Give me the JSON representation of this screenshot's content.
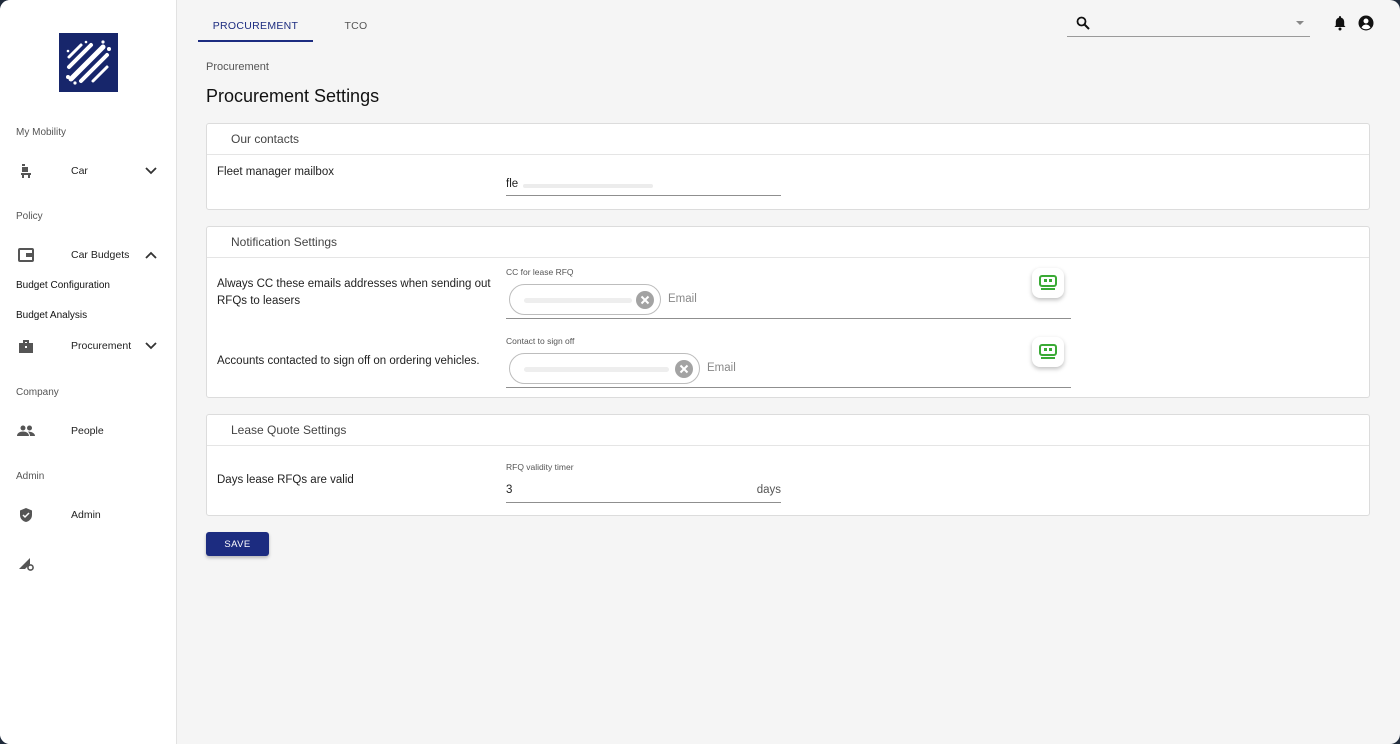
{
  "colors": {
    "brand": "#17266b",
    "accent": "#1c2c80",
    "extension": "#3aaa35"
  },
  "sidebar": {
    "sections": {
      "my_mobility": "My Mobility",
      "policy": "Policy",
      "company": "Company",
      "admin": "Admin"
    },
    "items": {
      "car": {
        "label": "Car",
        "icon": "car-seat-icon"
      },
      "car_budgets": {
        "label": "Car Budgets",
        "icon": "wallet-icon"
      },
      "budget_configuration": {
        "label": "Budget Configuration"
      },
      "budget_analysis": {
        "label": "Budget Analysis"
      },
      "procurement": {
        "label": "Procurement",
        "icon": "briefcase-icon"
      },
      "people": {
        "label": "People",
        "icon": "people-icon"
      },
      "admin": {
        "label": "Admin",
        "icon": "shield-icon"
      },
      "settings_tool": {
        "icon": "signal-gear-icon"
      }
    }
  },
  "topbar": {
    "tabs": [
      {
        "label": "PROCUREMENT",
        "active": true
      },
      {
        "label": "TCO",
        "active": false
      }
    ],
    "search": {
      "value": "",
      "placeholder": ""
    }
  },
  "breadcrumb": "Procurement",
  "page_title": "Procurement Settings",
  "contacts": {
    "title": "Our contacts",
    "fleet_label": "Fleet manager mailbox",
    "fleet_value": "fle"
  },
  "notifications": {
    "title": "Notification Settings",
    "cc_label": "Always CC these emails addresses when sending out RFQs to leasers",
    "cc_caption": "CC for lease RFQ",
    "cc_placeholder": "Email",
    "signoff_label": "Accounts contacted to sign off on ordering vehicles.",
    "signoff_caption": "Contact to sign off",
    "signoff_placeholder": "Email"
  },
  "lease": {
    "title": "Lease Quote Settings",
    "days_label": "Days lease RFQs are valid",
    "days_caption": "RFQ validity timer",
    "days_value": "3",
    "days_unit": "days"
  },
  "save_label": "SAVE"
}
